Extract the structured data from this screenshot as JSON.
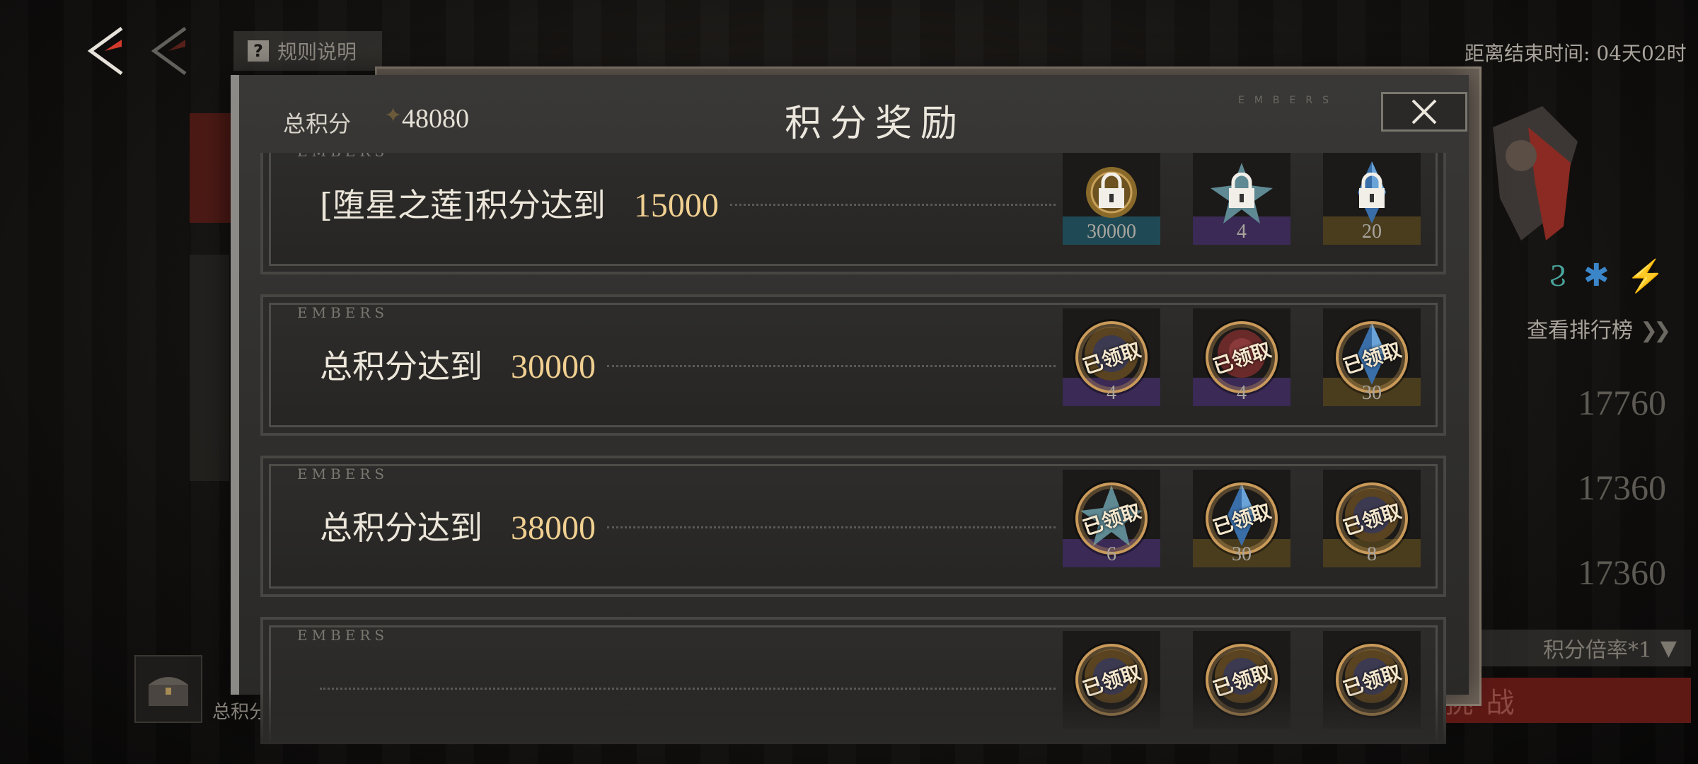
{
  "background": {
    "rules_label": "规则说明",
    "countdown": "距离结束时间: 04天02时",
    "rank_link": "查看排行榜",
    "scores": [
      "17760",
      "17360",
      "17360"
    ],
    "multiplier": "积分倍率*1",
    "challenge": "率人挑战",
    "bottom_label": "总积分"
  },
  "modal": {
    "title": "积分奖励",
    "total_label": "总积分",
    "total_value": "48080",
    "deco": "EMBERS"
  },
  "rows": [
    {
      "embers": "EMBERS",
      "label": "[堕星之莲]积分达到",
      "value": "15000",
      "rewards": [
        {
          "icon": "gold-coin-icon",
          "qty": "30000",
          "state": "locked",
          "tint": "#1f4a55"
        },
        {
          "icon": "star-fragment-icon",
          "qty": "4",
          "state": "locked",
          "tint": "#3a2a55"
        },
        {
          "icon": "blue-crystal-icon",
          "qty": "20",
          "state": "locked",
          "tint": "#4a3d1e"
        }
      ]
    },
    {
      "embers": "EMBERS",
      "label": "总积分达到",
      "value": "30000",
      "rewards": [
        {
          "icon": "gold-orb-icon",
          "qty": "4",
          "state": "claimed",
          "stamp": "已领取",
          "tint": "#3a2a55"
        },
        {
          "icon": "red-rose-icon",
          "qty": "4",
          "state": "claimed",
          "stamp": "已领取",
          "tint": "#3a2a55"
        },
        {
          "icon": "blue-crystal-icon",
          "qty": "30",
          "state": "claimed",
          "stamp": "已领取",
          "tint": "#4a3d1e"
        }
      ]
    },
    {
      "embers": "EMBERS",
      "label": "总积分达到",
      "value": "38000",
      "rewards": [
        {
          "icon": "star-fragment-icon",
          "qty": "6",
          "state": "claimed",
          "stamp": "已领取",
          "tint": "#3a2a55"
        },
        {
          "icon": "blue-crystal-icon",
          "qty": "30",
          "state": "claimed",
          "stamp": "已领取",
          "tint": "#4a3d1e"
        },
        {
          "icon": "gold-orb-icon",
          "qty": "8",
          "state": "claimed",
          "stamp": "已领取",
          "tint": "#4a3d1e"
        }
      ]
    },
    {
      "embers": "EMBERS",
      "label": "",
      "value": "",
      "rewards": [
        {
          "icon": "gold-orb-icon",
          "qty": "",
          "state": "claimed",
          "stamp": "已领取",
          "tint": "#1b1a18"
        },
        {
          "icon": "gold-orb-icon",
          "qty": "",
          "state": "claimed",
          "stamp": "已领取",
          "tint": "#1b1a18"
        },
        {
          "icon": "gold-orb-icon",
          "qty": "",
          "state": "claimed",
          "stamp": "已领取",
          "tint": "#1b1a18"
        }
      ]
    }
  ],
  "colors": {
    "accent_gold": "#f0cf91",
    "stamp_ring": "#c99a5a"
  }
}
